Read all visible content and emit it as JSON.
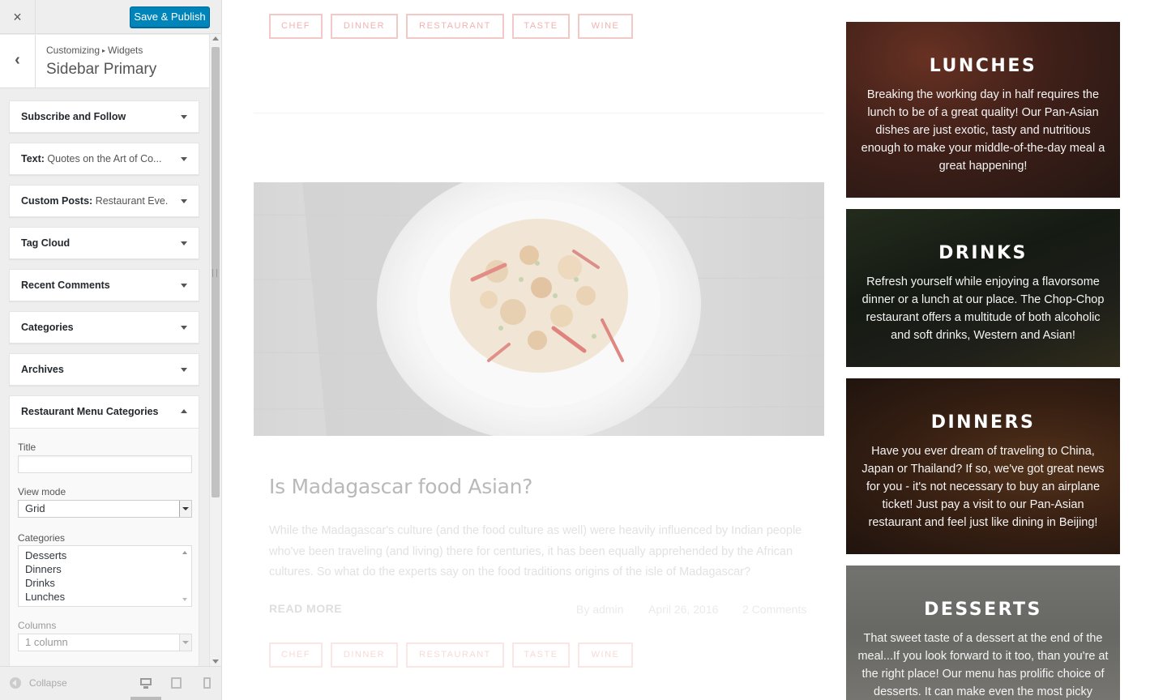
{
  "customizer": {
    "save_label": "Save & Publish",
    "close_icon": "×",
    "back_icon": "‹",
    "breadcrumb": [
      "Customizing",
      "Widgets"
    ],
    "breadcrumb_sep": "▸",
    "panel_title": "Sidebar Primary",
    "widgets": [
      {
        "title": "Subscribe and Follow",
        "subtitle": ""
      },
      {
        "title": "Text:",
        "subtitle": "Quotes on the Art of Co..."
      },
      {
        "title": "Custom Posts:",
        "subtitle": "Restaurant Eve..."
      },
      {
        "title": "Tag Cloud",
        "subtitle": ""
      },
      {
        "title": "Recent Comments",
        "subtitle": ""
      },
      {
        "title": "Categories",
        "subtitle": ""
      },
      {
        "title": "Archives",
        "subtitle": ""
      }
    ],
    "open_widget": {
      "title": "Restaurant Menu Categories",
      "title_label": "Title",
      "title_value": "",
      "view_mode_label": "View mode",
      "view_mode_value": "Grid",
      "categories_label": "Categories",
      "categories_options": [
        "Desserts",
        "Dinners",
        "Drinks",
        "Lunches"
      ],
      "columns_label": "Columns",
      "columns_value": "1 column"
    },
    "collapse_label": "Collapse",
    "devices": [
      "desktop-icon",
      "tablet-icon",
      "mobile-icon"
    ]
  },
  "preview": {
    "tags_top": [
      "CHEF",
      "DINNER",
      "RESTAURANT",
      "TASTE",
      "WINE"
    ],
    "tags_bottom": [
      "CHEF",
      "DINNER",
      "RESTAURANT",
      "TASTE",
      "WINE"
    ],
    "post": {
      "title": "Is Madagascar food Asian?",
      "excerpt": "While the Madagascar's culture (and the food culture as well) were heavily influenced by Indian people who've been traveling (and living) there for centuries, it has been equally apprehended by the African cultures. So what do the experts say on the food traditions origins of the isle of Madagascar?",
      "read_more": "READ MORE",
      "author": "By admin",
      "date": "April 26, 2016",
      "comments": "2 Comments"
    },
    "menu_cards": [
      {
        "title": "LUNCHES",
        "text": "Breaking the working day in half requires the lunch to be of a great quality! Our Pan-Asian dishes are just exotic, tasty and nutritious enough to make your middle-of-the-day meal a great happening!"
      },
      {
        "title": "DRINKS",
        "text": "Refresh yourself while enjoying a flavorsome dinner or a lunch at our place. The Chop-Chop restaurant offers a multitude of both alcoholic and soft drinks, Western and Asian!"
      },
      {
        "title": "DINNERS",
        "text": "Have you ever dream of traveling to China, Japan or Thailand? If so, we've got great news for you - it's not necessary to buy an airplane ticket! Just pay a visit to our Pan-Asian restaurant and feel just like dining in Beijing!"
      },
      {
        "title": "DESSERTS",
        "text": "That sweet taste of a dessert at the end of the meal...If you look forward to it too, than you're at the right place! Our menu has prolific choice of desserts. It can make even the most picky"
      }
    ]
  },
  "colors": {
    "accent": "#0085ba",
    "tag_border": "#f2c9c7",
    "sidebar_bg": "#eeeeee"
  }
}
